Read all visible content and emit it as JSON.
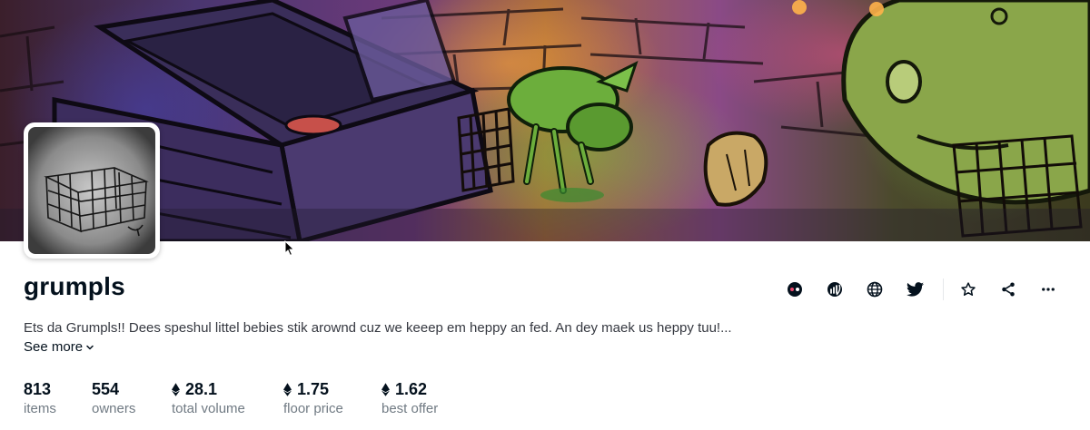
{
  "collection": {
    "name": "grumpls",
    "description": "Ets da Grumpls!! Dees speshul littel bebies stik arownd cuz we keeep em heppy an fed. An dey maek us heppy tuu!...",
    "see_more_label": "See more"
  },
  "actions": [
    {
      "icon": "opensea-pro-icon"
    },
    {
      "icon": "etherscan-icon"
    },
    {
      "icon": "globe-icon"
    },
    {
      "icon": "twitter-icon"
    },
    {
      "icon": "star-icon"
    },
    {
      "icon": "share-icon"
    },
    {
      "icon": "more-icon"
    }
  ],
  "stats": {
    "items": {
      "value": "813",
      "label": "items"
    },
    "owners": {
      "value": "554",
      "label": "owners"
    },
    "total_volume": {
      "value": "28.1",
      "label": "total volume",
      "currency_icon": "ethereum-icon"
    },
    "floor_price": {
      "value": "1.75",
      "label": "floor price",
      "currency_icon": "ethereum-icon"
    },
    "best_offer": {
      "value": "1.62",
      "label": "best offer",
      "currency_icon": "ethereum-icon"
    }
  },
  "colors": {
    "text_primary": "#04111d",
    "text_secondary": "#707a83",
    "description": "#353840"
  }
}
